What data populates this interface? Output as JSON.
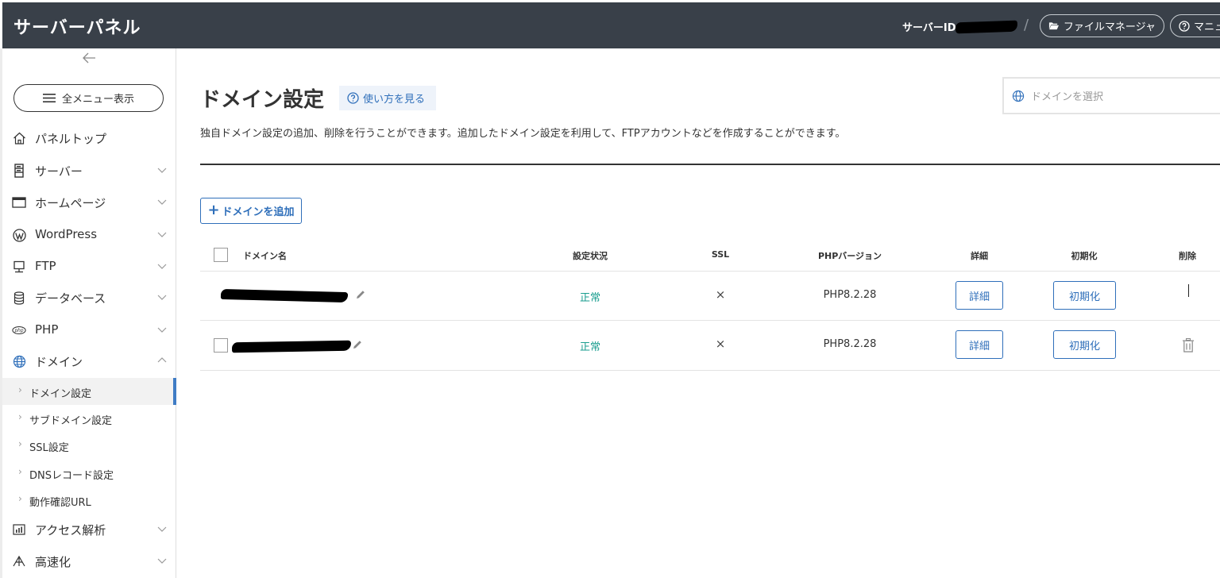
{
  "header": {
    "brand": "サーバーパネル",
    "server_id_label": "サーバーID",
    "slash": "/",
    "file_manager_label": "ファイルマネージャ",
    "manual_label": "マニュ"
  },
  "sidebar": {
    "all_menu_label": "全メニュー表示",
    "items": [
      {
        "label": "パネルトップ",
        "icon": "home-icon"
      },
      {
        "label": "サーバー",
        "icon": "server-icon"
      },
      {
        "label": "ホームページ",
        "icon": "window-icon"
      },
      {
        "label": "WordPress",
        "icon": "wordpress-icon"
      },
      {
        "label": "FTP",
        "icon": "monitor-icon"
      },
      {
        "label": "データベース",
        "icon": "database-icon"
      },
      {
        "label": "PHP",
        "icon": "php-icon"
      },
      {
        "label": "ドメイン",
        "icon": "globe-icon"
      },
      {
        "label": "アクセス解析",
        "icon": "bar-chart-icon"
      },
      {
        "label": "高速化",
        "icon": "rocket-icon"
      }
    ],
    "domain_sub_items": [
      {
        "label": "ドメイン設定"
      },
      {
        "label": "サブドメイン設定"
      },
      {
        "label": "SSL設定"
      },
      {
        "label": "DNSレコード設定"
      },
      {
        "label": "動作確認URL"
      }
    ]
  },
  "main": {
    "title": "ドメイン設定",
    "howto_label": "使い方を見る",
    "domain_select_placeholder": "ドメインを選択",
    "description": "独自ドメイン設定の追加、削除を行うことができます。追加したドメイン設定を利用して、FTPアカウントなどを作成することができます。",
    "add_button_label": "ドメインを追加",
    "add_button_plus": "+",
    "table": {
      "headers": {
        "domain": "ドメイン名",
        "status": "設定状況",
        "ssl": "SSL",
        "php": "PHPバージョン",
        "detail": "詳細",
        "init": "初期化",
        "delete": "削除"
      },
      "rows": [
        {
          "status": "正常",
          "ssl": "×",
          "php": "PHP8.2.28",
          "detail": "詳細",
          "init": "初期化"
        },
        {
          "status": "正常",
          "ssl": "×",
          "php": "PHP8.2.28",
          "detail": "詳細",
          "init": "初期化"
        }
      ]
    }
  },
  "colors": {
    "header_bg": "#394049",
    "accent_blue": "#2f6fba",
    "status_green": "#1a9e8f",
    "active_indicator": "#3f7cc5"
  }
}
